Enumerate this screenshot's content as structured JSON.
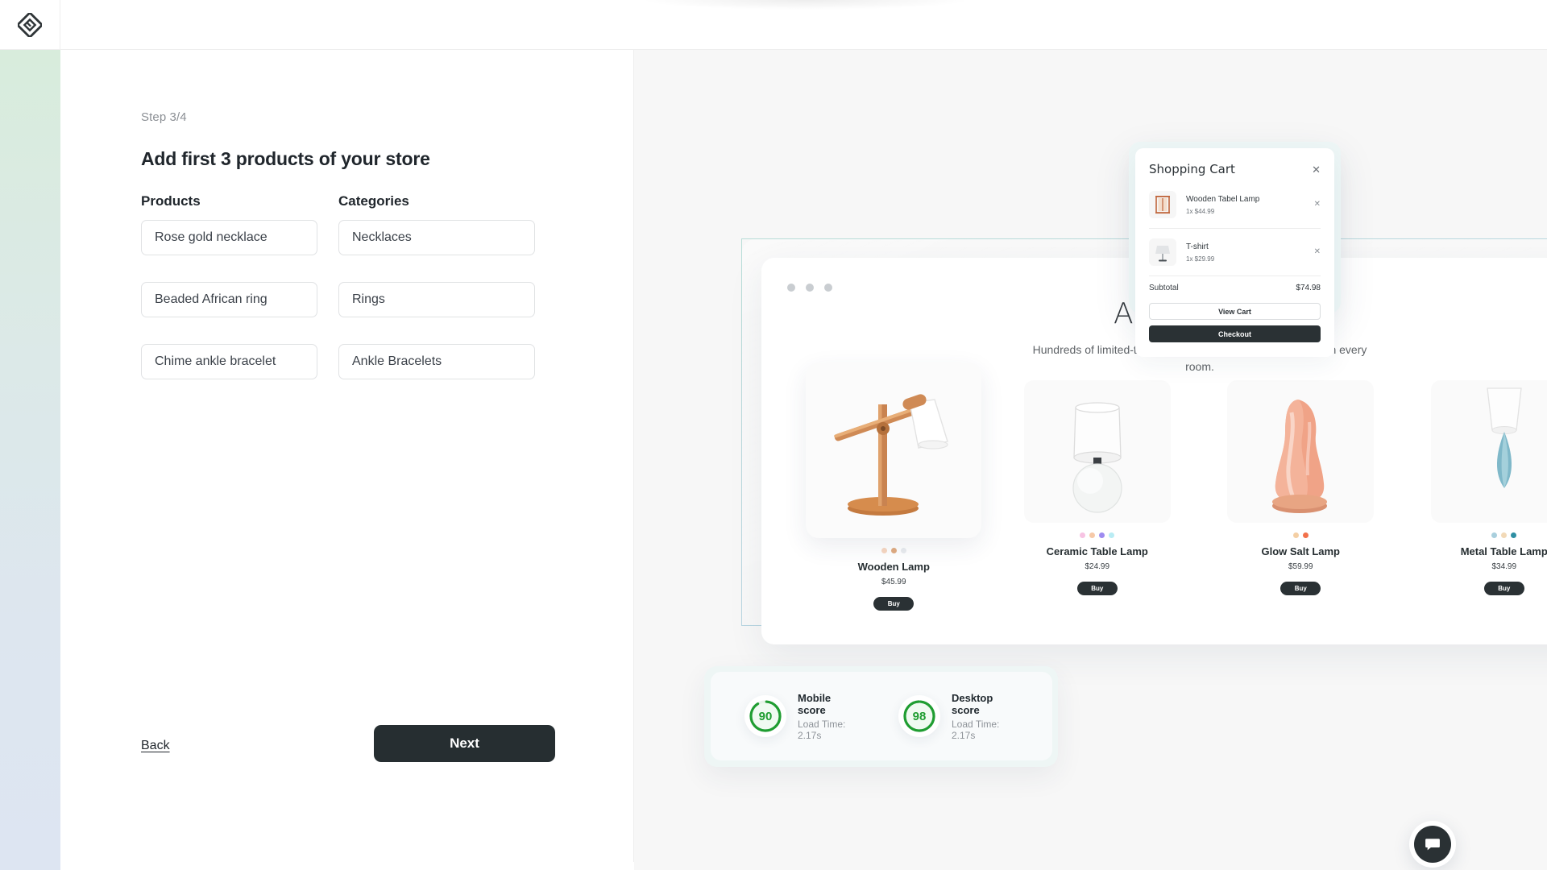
{
  "brand": {
    "logo_icon": "diamond-logo-icon"
  },
  "wizard": {
    "step_label": "Step 3/4",
    "title": "Add first 3 products of your store",
    "col_products": "Products",
    "col_categories": "Categories",
    "rows": [
      {
        "product": "Rose gold necklace",
        "category": "Necklaces"
      },
      {
        "product": "Beaded African ring",
        "category": "Rings"
      },
      {
        "product": "Chime ankle bracelet",
        "category": "Ankle Bracelets"
      }
    ],
    "back_label": "Back",
    "next_label": "Next"
  },
  "preview": {
    "store": {
      "title": "All Products",
      "subtitle": "Hundreds of limited-time deals on home essentials to refresh every room.",
      "buy_label": "Buy",
      "products": [
        {
          "name": "Wooden Lamp",
          "price": "$45.99",
          "swatches": [
            "#f7d7c2",
            "#e0ac82",
            "#e9ecef"
          ]
        },
        {
          "name": "Ceramic Table Lamp",
          "price": "$24.99",
          "swatches": [
            "#f7c3e3",
            "#f6c9a8",
            "#9e8bf0",
            "#b9ecf4"
          ]
        },
        {
          "name": "Glow Salt Lamp",
          "price": "$59.99",
          "swatches": [
            "#f4cfa4",
            "#f2714b"
          ]
        },
        {
          "name": "Metal Table Lamp",
          "price": "$34.99",
          "swatches": [
            "#a9cfdd",
            "#f2d9b7",
            "#2e8fa3"
          ]
        }
      ]
    },
    "cart": {
      "title": "Shopping Cart",
      "close_icon": "close-icon",
      "items": [
        {
          "name": "Wooden Tabel Lamp",
          "qty_price": "1x $44.99"
        },
        {
          "name": "T-shirt",
          "qty_price": "1x $29.99"
        }
      ],
      "subtotal_label": "Subtotal",
      "subtotal_value": "$74.98",
      "view_cart_label": "View Cart",
      "checkout_label": "Checkout"
    },
    "scores": [
      {
        "value": "90",
        "label": "Mobile score",
        "load_time": "Load Time: 2.17s",
        "percent": 90
      },
      {
        "value": "98",
        "label": "Desktop score",
        "load_time": "Load Time: 2.17s",
        "percent": 98
      }
    ],
    "chat_icon": "chat-bubble-icon"
  },
  "colors": {
    "accent_dark": "#2a3134",
    "score_green": "#1f9d31",
    "rail_top": "#d8ecdc",
    "rail_bottom": "#dde5f2"
  }
}
